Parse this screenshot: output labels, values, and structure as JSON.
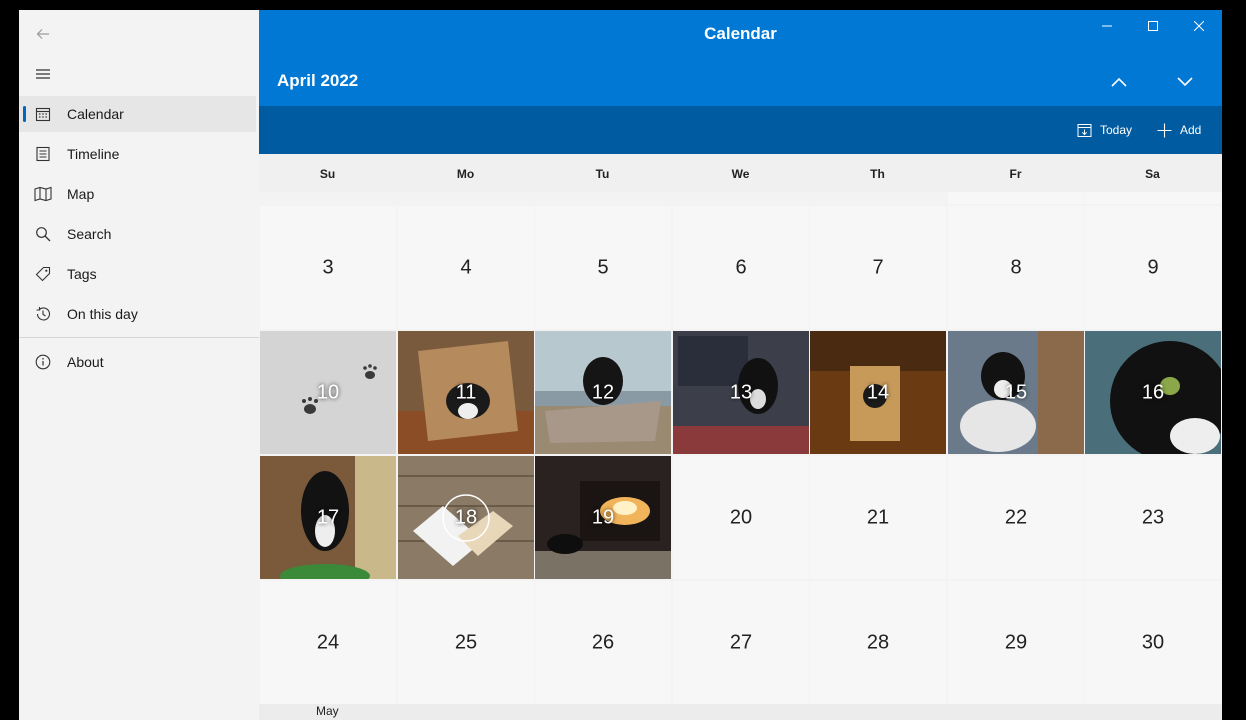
{
  "app": {
    "title": "Calendar"
  },
  "sidebar": {
    "items": [
      {
        "label": "Calendar",
        "icon": "calendar-icon",
        "active": true
      },
      {
        "label": "Timeline",
        "icon": "timeline-icon"
      },
      {
        "label": "Map",
        "icon": "map-icon"
      },
      {
        "label": "Search",
        "icon": "search-icon"
      },
      {
        "label": "Tags",
        "icon": "tag-icon"
      },
      {
        "label": "On this day",
        "icon": "history-icon"
      }
    ],
    "footer": {
      "about_label": "About",
      "icon": "info-icon"
    }
  },
  "header": {
    "month_title": "April 2022"
  },
  "commands": {
    "today_label": "Today",
    "add_label": "Add"
  },
  "weekdays": [
    "Su",
    "Mo",
    "Tu",
    "We",
    "Th",
    "Fr",
    "Sa"
  ],
  "weeks": [
    [
      {
        "day": "3"
      },
      {
        "day": "4"
      },
      {
        "day": "5"
      },
      {
        "day": "6"
      },
      {
        "day": "7"
      },
      {
        "day": "8"
      },
      {
        "day": "9"
      }
    ],
    [
      {
        "day": "10",
        "photo": "snow-paw-prints"
      },
      {
        "day": "11",
        "photo": "cat-in-paper-bag"
      },
      {
        "day": "12",
        "photo": "cat-on-window-hammock"
      },
      {
        "day": "13",
        "photo": "cat-on-desk"
      },
      {
        "day": "14",
        "photo": "cat-in-bag"
      },
      {
        "day": "15",
        "photo": "cat-on-table"
      },
      {
        "day": "16",
        "photo": "cat-closeup"
      }
    ],
    [
      {
        "day": "17",
        "photo": "cat-sitting"
      },
      {
        "day": "18",
        "photo": "video-notebook-on-wood"
      },
      {
        "day": "19",
        "photo": "cat-by-fireplace"
      },
      {
        "day": "20"
      },
      {
        "day": "21"
      },
      {
        "day": "22"
      },
      {
        "day": "23"
      }
    ],
    [
      {
        "day": "24"
      },
      {
        "day": "25"
      },
      {
        "day": "26"
      },
      {
        "day": "27"
      },
      {
        "day": "28"
      },
      {
        "day": "29"
      },
      {
        "day": "30"
      }
    ]
  ],
  "next_month_label": "May",
  "colors": {
    "accent": "#0078d4",
    "command_bar": "#005ba1"
  }
}
